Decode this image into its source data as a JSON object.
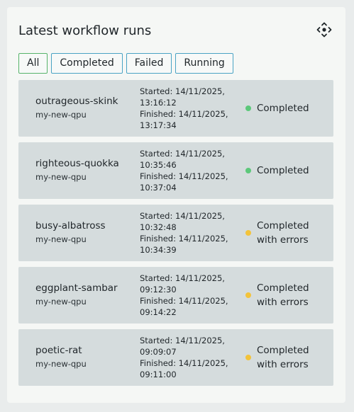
{
  "header": {
    "title": "Latest workflow runs",
    "move_icon": "move-arrows-icon"
  },
  "filters": [
    {
      "label": "All",
      "active": true
    },
    {
      "label": "Completed",
      "active": false
    },
    {
      "label": "Failed",
      "active": false
    },
    {
      "label": "Running",
      "active": false
    }
  ],
  "colors": {
    "success": "#5cc87a",
    "warning": "#f3c33a",
    "active_tab_border": "#56b36a",
    "tab_border": "#4aa3c4"
  },
  "runs": [
    {
      "name": "outrageous-skink",
      "env": "my-new-qpu",
      "started_line1": "Started: 14/11/2025,",
      "started_line2": "13:16:12",
      "finished_line1": "Finished: 14/11/2025,",
      "finished_line2": "13:17:34",
      "status": "Completed",
      "status_color": "#5cc87a"
    },
    {
      "name": "righteous-quokka",
      "env": "my-new-qpu",
      "started_line1": "Started: 14/11/2025,",
      "started_line2": "10:35:46",
      "finished_line1": "Finished: 14/11/2025,",
      "finished_line2": "10:37:04",
      "status": "Completed",
      "status_color": "#5cc87a"
    },
    {
      "name": "busy-albatross",
      "env": "my-new-qpu",
      "started_line1": "Started: 14/11/2025,",
      "started_line2": "10:32:48",
      "finished_line1": "Finished: 14/11/2025,",
      "finished_line2": "10:34:39",
      "status": "Completed with errors",
      "status_color": "#f3c33a"
    },
    {
      "name": "eggplant-sambar",
      "env": "my-new-qpu",
      "started_line1": "Started: 14/11/2025,",
      "started_line2": "09:12:30",
      "finished_line1": "Finished: 14/11/2025,",
      "finished_line2": "09:14:22",
      "status": "Completed with errors",
      "status_color": "#f3c33a"
    },
    {
      "name": "poetic-rat",
      "env": "my-new-qpu",
      "started_line1": "Started: 14/11/2025,",
      "started_line2": "09:09:07",
      "finished_line1": "Finished: 14/11/2025,",
      "finished_line2": "09:11:00",
      "status": "Completed with errors",
      "status_color": "#f3c33a"
    }
  ]
}
